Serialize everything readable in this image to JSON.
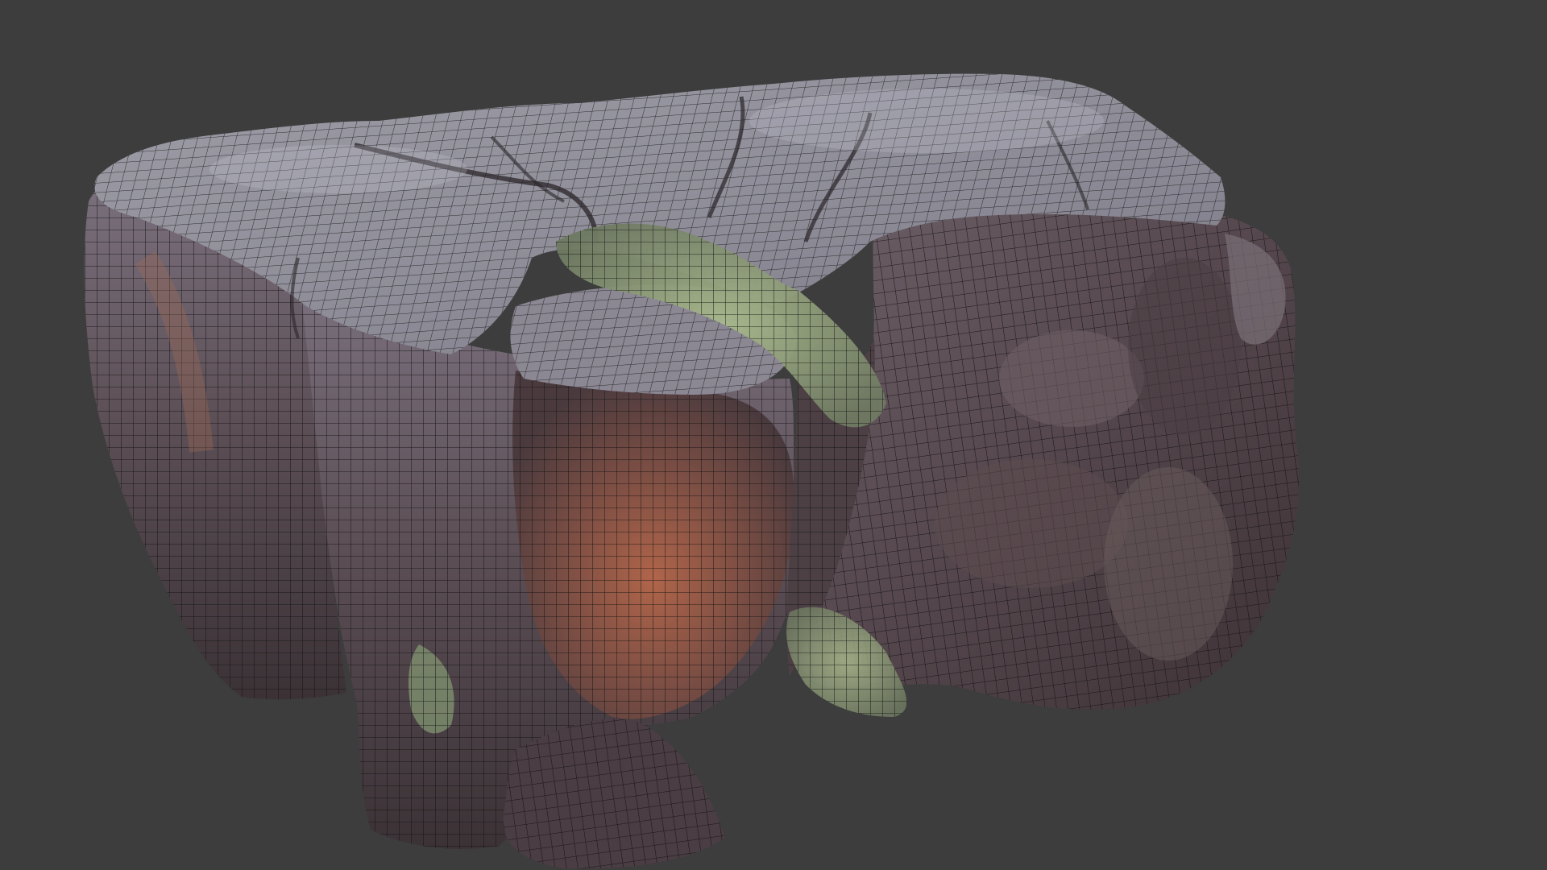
{
  "viewport": {
    "background_color": "#3d3d3d",
    "shading": "material-preview",
    "overlay": "wireframe",
    "wire_color": "#111111"
  },
  "scene": {
    "object": "tree-stump-scan-mesh",
    "colors": {
      "bark_light": "#8e8d97",
      "bark_mid": "#6a6370",
      "bark_dark": "#3c3338",
      "heartwood": "#9a5a3e",
      "moss": "#8fa27a",
      "shadow": "#2a2527"
    }
  }
}
